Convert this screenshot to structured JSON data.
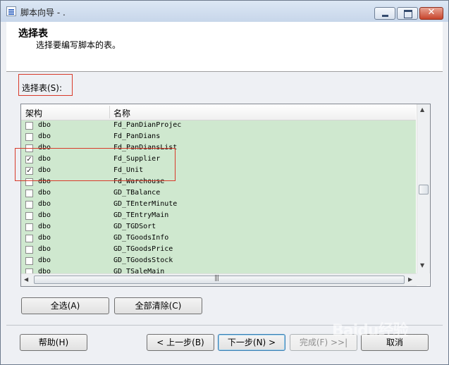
{
  "window": {
    "title": "脚本向导 - ."
  },
  "header": {
    "title": "选择表",
    "subtitle": "选择要编写脚本的表。"
  },
  "select_label": "选择表(S):",
  "table": {
    "columns": [
      "架构",
      "名称"
    ],
    "rows": [
      {
        "checked": false,
        "schema": "dbo",
        "name": "Fd_PanDianProjec"
      },
      {
        "checked": false,
        "schema": "dbo",
        "name": "Fd_PanDians"
      },
      {
        "checked": false,
        "schema": "dbo",
        "name": "Fd_PanDiansList"
      },
      {
        "checked": true,
        "schema": "dbo",
        "name": "Fd_Supplier"
      },
      {
        "checked": true,
        "schema": "dbo",
        "name": "Fd_Unit"
      },
      {
        "checked": false,
        "schema": "dbo",
        "name": "Fd_Warehouse"
      },
      {
        "checked": false,
        "schema": "dbo",
        "name": "GD_TBalance"
      },
      {
        "checked": false,
        "schema": "dbo",
        "name": "GD_TEnterMinute"
      },
      {
        "checked": false,
        "schema": "dbo",
        "name": "GD_TEntryMain"
      },
      {
        "checked": false,
        "schema": "dbo",
        "name": "GD_TGDSort"
      },
      {
        "checked": false,
        "schema": "dbo",
        "name": "GD_TGoodsInfo"
      },
      {
        "checked": false,
        "schema": "dbo",
        "name": "GD_TGoodsPrice"
      },
      {
        "checked": false,
        "schema": "dbo",
        "name": "GD_TGoodsStock"
      },
      {
        "checked": false,
        "schema": "dbo",
        "name": "GD_TSaleMain"
      }
    ]
  },
  "buttons": {
    "select_all": "全选(A)",
    "clear_all": "全部清除(C)",
    "help": "帮助(H)",
    "back": "< 上一步(B)",
    "next": "下一步(N) >",
    "finish": "完成(F) >>|",
    "cancel": "取消"
  },
  "watermark": "Baidu经验",
  "colors": {
    "row_background": "#cfe8cf",
    "highlight_border": "#d83a2a",
    "close_button": "#c7442b"
  }
}
